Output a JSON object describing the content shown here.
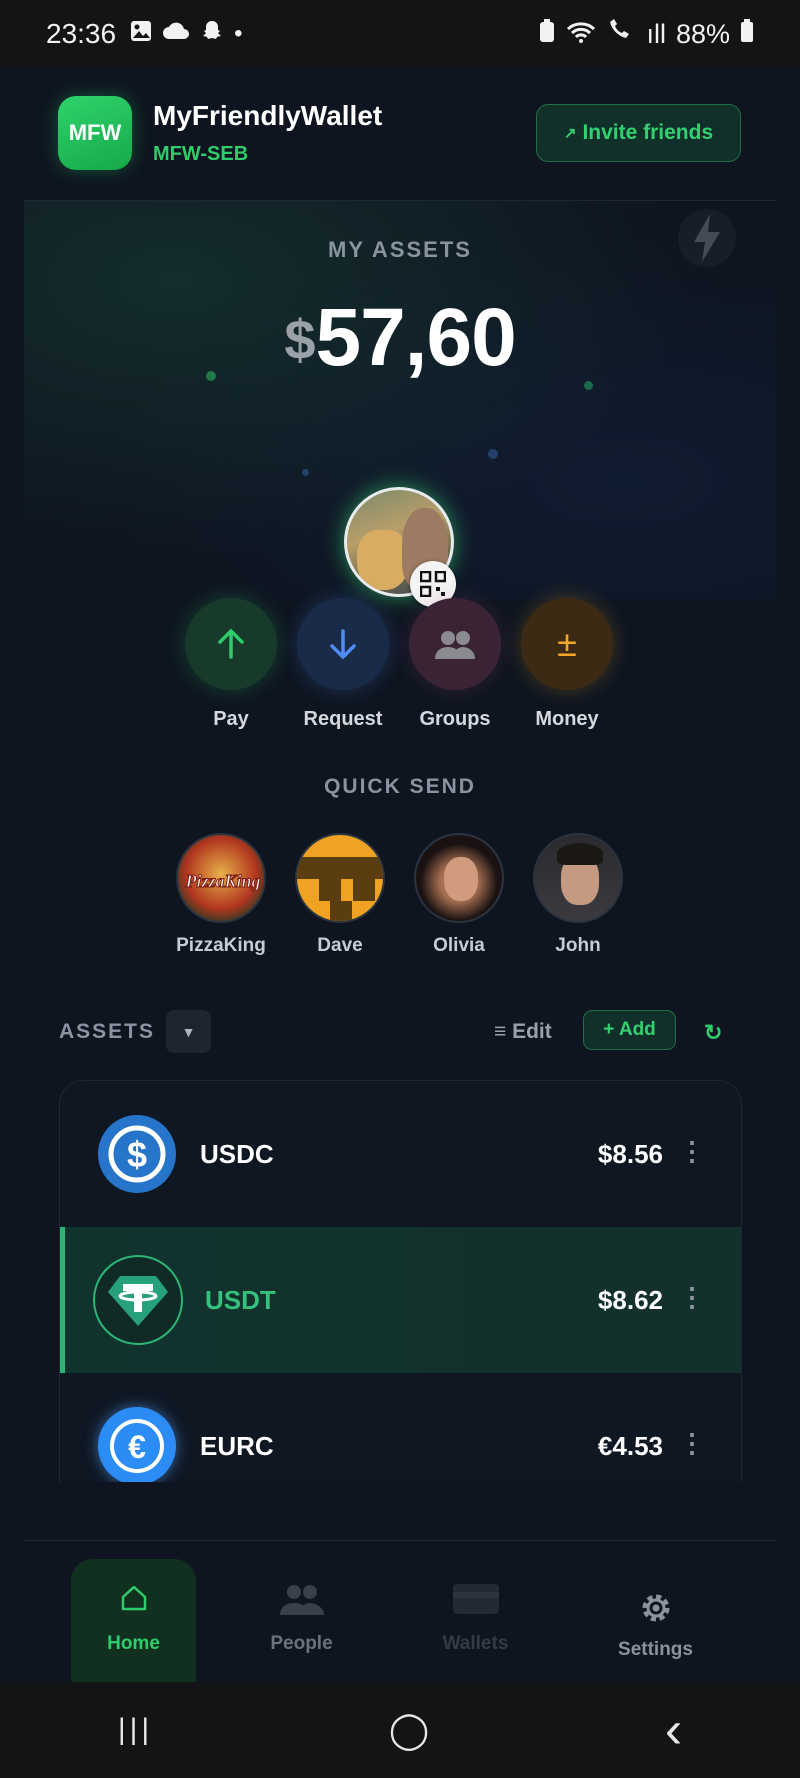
{
  "status_bar": {
    "time": "23:36",
    "dot": "•",
    "battery": "88%",
    "signal": "ıll"
  },
  "header": {
    "logo_text": "MFW",
    "title": "MyFriendlyWallet",
    "subtitle": "MFW-SEB",
    "invite_label": "Invite friends",
    "invite_arrow": "↗"
  },
  "hero": {
    "label": "MY ASSETS",
    "currency_symbol": "$",
    "amount": "57,60"
  },
  "actions": [
    {
      "label": "Pay",
      "glyph": "↑",
      "color": "#2ecc6a",
      "bg": "#173a2a"
    },
    {
      "label": "Request",
      "glyph": "↓",
      "color": "#4f8df5",
      "bg": "#1a2b4a"
    },
    {
      "label": "Groups",
      "glyph": "people-icon",
      "color": "#8a8a90",
      "bg": "#3a2334"
    },
    {
      "label": "Money",
      "glyph": "±",
      "color": "#f5a623",
      "bg": "#3d2a14"
    }
  ],
  "quick_send": {
    "title": "QUICK SEND",
    "contacts": [
      {
        "name": "PizzaKing"
      },
      {
        "name": "Dave"
      },
      {
        "name": "Olivia"
      },
      {
        "name": "John"
      }
    ]
  },
  "assets_bar": {
    "label": "ASSETS",
    "dropdown_glyph": "▼",
    "edit_label": "≡ Edit",
    "add_label": "+ Add",
    "refresh_glyph": "↻"
  },
  "assets": [
    {
      "name": "USDC",
      "value": "$8.56",
      "more": "⋮",
      "icon_glyph": "$",
      "icon_color": "#2775ca"
    },
    {
      "name": "USDT",
      "value": "$8.62",
      "more": "⋮",
      "icon_glyph": "T",
      "icon_color": "#26a17b",
      "active": true
    },
    {
      "name": "EURC",
      "value": "€4.53",
      "more": "⋮",
      "icon_glyph": "€",
      "icon_color": "#2b8cf5"
    }
  ],
  "bottom_nav": [
    {
      "label": "Home",
      "icon": "home-icon",
      "glyph": "⌂",
      "color": "#2ecc6a",
      "active": true
    },
    {
      "label": "People",
      "icon": "people-icon",
      "color": "#5b626b"
    },
    {
      "label": "Wallets",
      "icon": "wallet-icon",
      "color": "#333b45"
    },
    {
      "label": "Settings",
      "icon": "gear-icon",
      "glyph": "⚙",
      "color": "#8a939c"
    }
  ],
  "system_nav": {
    "recents": "|||",
    "home": "◯",
    "back": "‹"
  }
}
